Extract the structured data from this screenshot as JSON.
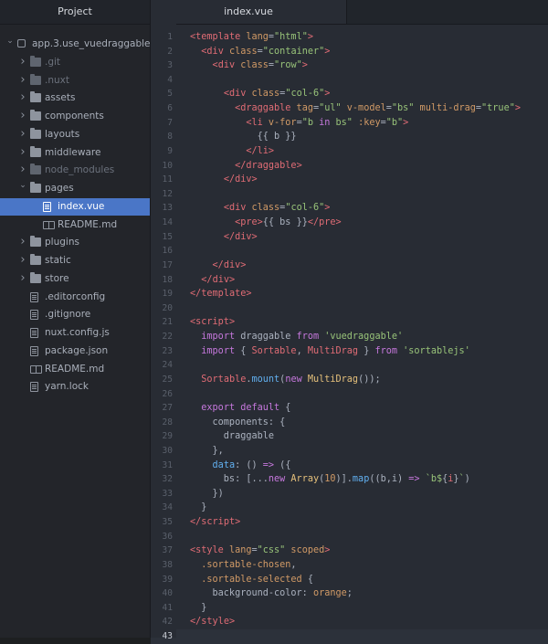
{
  "sidebar": {
    "title": "Project",
    "items": [
      {
        "label": "app.3.use_vuedraggable",
        "depth": 0,
        "kind": "repo",
        "expanded": true,
        "icon": "repo-icon"
      },
      {
        "label": ".git",
        "depth": 1,
        "kind": "folder",
        "expanded": false,
        "ignored": true,
        "icon": "folder-icon"
      },
      {
        "label": ".nuxt",
        "depth": 1,
        "kind": "folder",
        "expanded": false,
        "ignored": true,
        "icon": "folder-icon"
      },
      {
        "label": "assets",
        "depth": 1,
        "kind": "folder",
        "expanded": false,
        "icon": "folder-icon"
      },
      {
        "label": "components",
        "depth": 1,
        "kind": "folder",
        "expanded": false,
        "icon": "folder-icon"
      },
      {
        "label": "layouts",
        "depth": 1,
        "kind": "folder",
        "expanded": false,
        "icon": "folder-icon"
      },
      {
        "label": "middleware",
        "depth": 1,
        "kind": "folder",
        "expanded": false,
        "icon": "folder-icon"
      },
      {
        "label": "node_modules",
        "depth": 1,
        "kind": "folder",
        "expanded": false,
        "ignored": true,
        "icon": "folder-icon"
      },
      {
        "label": "pages",
        "depth": 1,
        "kind": "folder",
        "expanded": true,
        "icon": "folder-icon"
      },
      {
        "label": "index.vue",
        "depth": 2,
        "kind": "file",
        "selected": true,
        "icon": "file-icon"
      },
      {
        "label": "README.md",
        "depth": 2,
        "kind": "book",
        "icon": "book-icon"
      },
      {
        "label": "plugins",
        "depth": 1,
        "kind": "folder",
        "expanded": false,
        "icon": "folder-icon"
      },
      {
        "label": "static",
        "depth": 1,
        "kind": "folder",
        "expanded": false,
        "icon": "folder-icon"
      },
      {
        "label": "store",
        "depth": 1,
        "kind": "folder",
        "expanded": false,
        "icon": "folder-icon"
      },
      {
        "label": ".editorconfig",
        "depth": 1,
        "kind": "file",
        "icon": "file-icon"
      },
      {
        "label": ".gitignore",
        "depth": 1,
        "kind": "file",
        "icon": "file-icon"
      },
      {
        "label": "nuxt.config.js",
        "depth": 1,
        "kind": "file",
        "icon": "file-icon"
      },
      {
        "label": "package.json",
        "depth": 1,
        "kind": "file",
        "icon": "file-icon"
      },
      {
        "label": "README.md",
        "depth": 1,
        "kind": "book",
        "icon": "book-icon"
      },
      {
        "label": "yarn.lock",
        "depth": 1,
        "kind": "file",
        "icon": "file-icon"
      }
    ]
  },
  "editor": {
    "tab_label": "index.vue",
    "current_line": 43,
    "colors": {
      "tag": "#e06c75",
      "attr": "#d19a66",
      "string": "#98c379",
      "keyword": "#c678dd",
      "func": "#61afef",
      "class": "#e5c07b",
      "plain": "#abb2bf",
      "punct": "#abb2bf"
    },
    "lines": [
      [
        [
          "t",
          "<"
        ],
        [
          "g",
          "template"
        ],
        [
          "a",
          " lang"
        ],
        [
          "p",
          "="
        ],
        [
          "s",
          "\"html\""
        ],
        [
          "t",
          ">"
        ]
      ],
      [
        [
          "p",
          "  "
        ],
        [
          "t",
          "<"
        ],
        [
          "g",
          "div"
        ],
        [
          "a",
          " class"
        ],
        [
          "p",
          "="
        ],
        [
          "s",
          "\"container\""
        ],
        [
          "t",
          ">"
        ]
      ],
      [
        [
          "p",
          "    "
        ],
        [
          "t",
          "<"
        ],
        [
          "g",
          "div"
        ],
        [
          "a",
          " class"
        ],
        [
          "p",
          "="
        ],
        [
          "s",
          "\"row\""
        ],
        [
          "t",
          ">"
        ]
      ],
      [],
      [
        [
          "p",
          "      "
        ],
        [
          "t",
          "<"
        ],
        [
          "g",
          "div"
        ],
        [
          "a",
          " class"
        ],
        [
          "p",
          "="
        ],
        [
          "s",
          "\"col-6\""
        ],
        [
          "t",
          ">"
        ]
      ],
      [
        [
          "p",
          "        "
        ],
        [
          "t",
          "<"
        ],
        [
          "g",
          "draggable"
        ],
        [
          "a",
          " tag"
        ],
        [
          "p",
          "="
        ],
        [
          "s",
          "\"ul\""
        ],
        [
          "a",
          " v-model"
        ],
        [
          "p",
          "="
        ],
        [
          "s",
          "\"bs\""
        ],
        [
          "a",
          " multi-drag"
        ],
        [
          "p",
          "="
        ],
        [
          "s",
          "\"true\""
        ],
        [
          "t",
          ">"
        ]
      ],
      [
        [
          "p",
          "          "
        ],
        [
          "t",
          "<"
        ],
        [
          "g",
          "li"
        ],
        [
          "a",
          " v-for"
        ],
        [
          "p",
          "="
        ],
        [
          "s",
          "\"b "
        ],
        [
          "k",
          "in"
        ],
        [
          "s",
          " bs\""
        ],
        [
          "a",
          " :key"
        ],
        [
          "p",
          "="
        ],
        [
          "s",
          "\"b\""
        ],
        [
          "t",
          ">"
        ]
      ],
      [
        [
          "p",
          "            {{ b }}"
        ]
      ],
      [
        [
          "p",
          "          "
        ],
        [
          "t",
          "</"
        ],
        [
          "g",
          "li"
        ],
        [
          "t",
          ">"
        ]
      ],
      [
        [
          "p",
          "        "
        ],
        [
          "t",
          "</"
        ],
        [
          "g",
          "draggable"
        ],
        [
          "t",
          ">"
        ]
      ],
      [
        [
          "p",
          "      "
        ],
        [
          "t",
          "</"
        ],
        [
          "g",
          "div"
        ],
        [
          "t",
          ">"
        ]
      ],
      [],
      [
        [
          "p",
          "      "
        ],
        [
          "t",
          "<"
        ],
        [
          "g",
          "div"
        ],
        [
          "a",
          " class"
        ],
        [
          "p",
          "="
        ],
        [
          "s",
          "\"col-6\""
        ],
        [
          "t",
          ">"
        ]
      ],
      [
        [
          "p",
          "        "
        ],
        [
          "t",
          "<"
        ],
        [
          "g",
          "pre"
        ],
        [
          "t",
          ">"
        ],
        [
          "p",
          "{{ bs }}"
        ],
        [
          "t",
          "</"
        ],
        [
          "g",
          "pre"
        ],
        [
          "t",
          ">"
        ]
      ],
      [
        [
          "p",
          "      "
        ],
        [
          "t",
          "</"
        ],
        [
          "g",
          "div"
        ],
        [
          "t",
          ">"
        ]
      ],
      [],
      [
        [
          "p",
          "    "
        ],
        [
          "t",
          "</"
        ],
        [
          "g",
          "div"
        ],
        [
          "t",
          ">"
        ]
      ],
      [
        [
          "p",
          "  "
        ],
        [
          "t",
          "</"
        ],
        [
          "g",
          "div"
        ],
        [
          "t",
          ">"
        ]
      ],
      [
        [
          "t",
          "</"
        ],
        [
          "g",
          "template"
        ],
        [
          "t",
          ">"
        ]
      ],
      [],
      [
        [
          "t",
          "<"
        ],
        [
          "g",
          "script"
        ],
        [
          "t",
          ">"
        ]
      ],
      [
        [
          "p",
          "  "
        ],
        [
          "k",
          "import"
        ],
        [
          "p",
          " draggable "
        ],
        [
          "k",
          "from"
        ],
        [
          "p",
          " "
        ],
        [
          "s",
          "'vuedraggable'"
        ]
      ],
      [
        [
          "p",
          "  "
        ],
        [
          "k",
          "import"
        ],
        [
          "p",
          " { "
        ],
        [
          "g",
          "Sortable"
        ],
        [
          "p",
          ", "
        ],
        [
          "g",
          "MultiDrag"
        ],
        [
          "p",
          " } "
        ],
        [
          "k",
          "from"
        ],
        [
          "p",
          " "
        ],
        [
          "s",
          "'sortablejs'"
        ]
      ],
      [],
      [
        [
          "p",
          "  "
        ],
        [
          "g",
          "Sortable"
        ],
        [
          "p",
          "."
        ],
        [
          "f",
          "mount"
        ],
        [
          "p",
          "("
        ],
        [
          "k",
          "new"
        ],
        [
          "p",
          " "
        ],
        [
          "c",
          "MultiDrag"
        ],
        [
          "p",
          "());"
        ]
      ],
      [],
      [
        [
          "p",
          "  "
        ],
        [
          "k",
          "export"
        ],
        [
          "p",
          " "
        ],
        [
          "k",
          "default"
        ],
        [
          "p",
          " {"
        ]
      ],
      [
        [
          "p",
          "    components: {"
        ]
      ],
      [
        [
          "p",
          "      draggable"
        ]
      ],
      [
        [
          "p",
          "    },"
        ]
      ],
      [
        [
          "p",
          "    "
        ],
        [
          "f",
          "data"
        ],
        [
          "p",
          ": () "
        ],
        [
          "k",
          "=>"
        ],
        [
          "p",
          " ({"
        ]
      ],
      [
        [
          "p",
          "      bs: [..."
        ],
        [
          "k",
          "new"
        ],
        [
          "p",
          " "
        ],
        [
          "c",
          "Array"
        ],
        [
          "p",
          "("
        ],
        [
          "a",
          "10"
        ],
        [
          "p",
          ")]."
        ],
        [
          "f",
          "map"
        ],
        [
          "p",
          "((b,i) "
        ],
        [
          "k",
          "=>"
        ],
        [
          "p",
          " "
        ],
        [
          "s",
          "`b$"
        ],
        [
          "p",
          "{"
        ],
        [
          "g",
          "i"
        ],
        [
          "p",
          "}"
        ],
        [
          "s",
          "`"
        ],
        [
          "p",
          ")"
        ]
      ],
      [
        [
          "p",
          "    })"
        ]
      ],
      [
        [
          "p",
          "  }"
        ]
      ],
      [
        [
          "t",
          "</"
        ],
        [
          "g",
          "script"
        ],
        [
          "t",
          ">"
        ]
      ],
      [],
      [
        [
          "t",
          "<"
        ],
        [
          "g",
          "style"
        ],
        [
          "a",
          " lang"
        ],
        [
          "p",
          "="
        ],
        [
          "s",
          "\"css\""
        ],
        [
          "a",
          " scoped"
        ],
        [
          "t",
          ">"
        ]
      ],
      [
        [
          "p",
          "  "
        ],
        [
          "a",
          ".sortable-chosen"
        ],
        [
          "p",
          ","
        ]
      ],
      [
        [
          "p",
          "  "
        ],
        [
          "a",
          ".sortable-selected"
        ],
        [
          "p",
          " {"
        ]
      ],
      [
        [
          "p",
          "    background-color: "
        ],
        [
          "a",
          "orange"
        ],
        [
          "p",
          ";"
        ]
      ],
      [
        [
          "p",
          "  }"
        ]
      ],
      [
        [
          "t",
          "</"
        ],
        [
          "g",
          "style"
        ],
        [
          "t",
          ">"
        ]
      ],
      []
    ]
  }
}
